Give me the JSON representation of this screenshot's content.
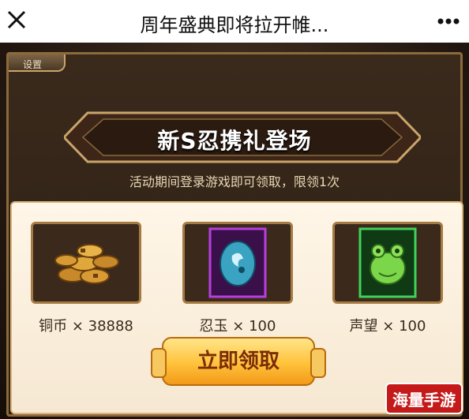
{
  "header": {
    "title": "周年盛典即将拉开帷...",
    "close_icon": "close-icon",
    "more_icon": "more-dots-icon"
  },
  "game": {
    "tab_stub_label": "设置",
    "banner_title": "新S忍携礼登场",
    "subtitle": "活动期间登录游戏即可领取，限领1次",
    "rewards": [
      {
        "label": "铜币 × 38888",
        "icon": "coins-icon"
      },
      {
        "label": "忍玉 × 100",
        "icon": "jade-stone-icon"
      },
      {
        "label": "声望 × 100",
        "icon": "frog-token-icon"
      }
    ],
    "claim_button": "立即领取"
  },
  "watermark": {
    "text": "海量手游网"
  },
  "colors": {
    "accent_gold": "#ffc23a",
    "panel_brown": "#3b2a1c",
    "frame_gold": "#a57b43",
    "watermark_red": "#c51a1a"
  }
}
